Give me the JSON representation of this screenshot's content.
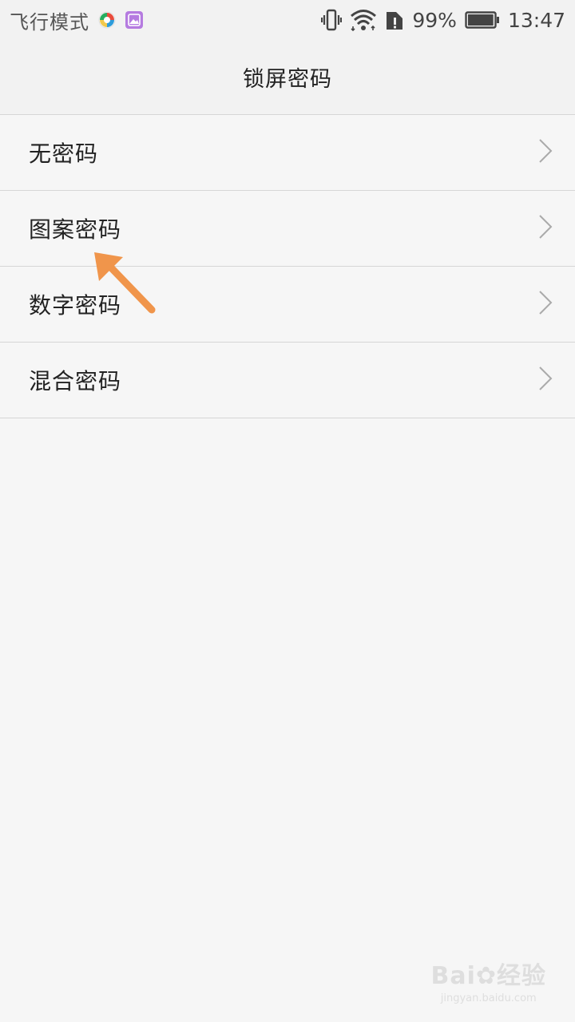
{
  "status_bar": {
    "mode_label": "飞行模式",
    "battery_percent": "99%",
    "time": "13:47",
    "icons": [
      "app-icon-colorful",
      "gallery-app-icon",
      "vibrate-icon",
      "wifi-icon",
      "sim-alert-icon",
      "battery-icon"
    ],
    "battery_level": 0.99
  },
  "header": {
    "title": "锁屏密码"
  },
  "options": [
    {
      "label": "无密码"
    },
    {
      "label": "图案密码"
    },
    {
      "label": "数字密码"
    },
    {
      "label": "混合密码"
    }
  ],
  "annotation": {
    "arrow_color": "#f0954b",
    "points_to": "图案密码"
  },
  "watermark": {
    "brand": "Bai",
    "brand_suffix": "经验",
    "url": "jingyan.baidu.com"
  },
  "colors": {
    "background": "#f6f6f6",
    "divider": "#d6d6d6",
    "chevron": "#aaaaaa"
  }
}
